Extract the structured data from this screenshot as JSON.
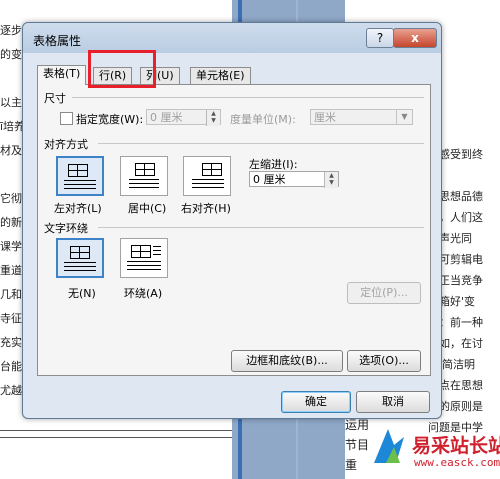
{
  "background": {
    "left_lines": [
      "逐步…便阵地",
      "的变革",
      "",
      "以主要",
      "ī培养",
      "材及",
      "",
      "它彻",
      "的新",
      "课学习",
      "重道",
      "几和同",
      "寺征，",
      "充实，",
      "台能，",
      "尤越的"
    ],
    "right_lines": [
      "步感受到终",
      "",
      "在思想品德",
      "明，人们这",
      "用声光同",
      "师可剪辑电",
      "不正当竞争",
      "冰箱好'变",
      "睛：前一种",
      "比如，在讨",
      "。'简洁明",
      "热点在思想",
      "际的原则是",
      "问题是中学"
    ],
    "bottom_lines": [
      "运用",
      "节目",
      "重"
    ],
    "watermark_title": "易采站长站",
    "watermark_url": "www.easck.com"
  },
  "dialog": {
    "title": "表格属性",
    "help_label": "?",
    "close_label": "x",
    "tabs": [
      {
        "label": "表格(T)",
        "active": true
      },
      {
        "label": "行(R)",
        "active": false
      },
      {
        "label": "列(U)",
        "active": false
      },
      {
        "label": "单元格(E)",
        "active": false
      }
    ],
    "size": {
      "section_label": "尺寸",
      "preferred_width_label": "指定宽度(W):",
      "width_value": "0 厘米",
      "unit_label": "度量单位(M):",
      "unit_value": "厘米"
    },
    "alignment": {
      "section_label": "对齐方式",
      "options": [
        "左对齐(L)",
        "居中(C)",
        "右对齐(H)"
      ],
      "indent_label": "左缩进(I):",
      "indent_value": "0 厘米"
    },
    "wrapping": {
      "section_label": "文字环绕",
      "options": [
        "无(N)",
        "环绕(A)"
      ],
      "position_button": "定位(P)..."
    },
    "borders_button": "边框和底纹(B)...",
    "options_button": "选项(O)...",
    "ok_button": "确定",
    "cancel_button": "取消"
  }
}
